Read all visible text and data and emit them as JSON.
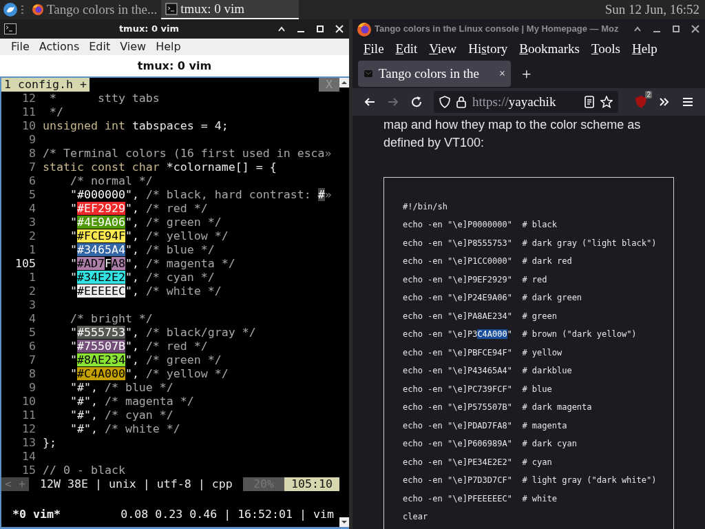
{
  "taskbar": {
    "items": [
      {
        "kind": "browser",
        "label": "Tango colors in the...",
        "selected": false
      },
      {
        "kind": "terminal",
        "label": "tmux: 0 vim",
        "selected": true
      }
    ],
    "clock": "Sun 12 Jun, 16:52"
  },
  "terminal": {
    "title": "tmux: 0 vim",
    "menu": [
      "File",
      "Actions",
      "Edit",
      "View",
      "Help"
    ],
    "tab_title": "tmux: 0 vim",
    "vim": {
      "tab": "1 config.h +",
      "close": "X",
      "lines": [
        {
          "number": "12",
          "current": false,
          "segments": [
            {
              "kind": "comment",
              "text": " *      stty tabs"
            }
          ]
        },
        {
          "number": "11",
          "current": false,
          "segments": [
            {
              "kind": "comment",
              "text": " */"
            }
          ]
        },
        {
          "number": "10",
          "current": false,
          "segments": [
            {
              "kind": "type",
              "text": "unsigned int"
            },
            {
              "kind": "text",
              "text": " tabspaces = 4;"
            }
          ]
        },
        {
          "number": "9",
          "current": false
        },
        {
          "number": "8",
          "current": false,
          "segments": [
            {
              "kind": "comment",
              "text": "/* Terminal colors (16 first used in esca"
            },
            {
              "kind": "more",
              "text": "»"
            }
          ]
        },
        {
          "number": "7",
          "current": false,
          "segments": [
            {
              "kind": "type",
              "text": "static const char"
            },
            {
              "kind": "text",
              "text": " *colorname[] = {"
            }
          ]
        },
        {
          "number": "6",
          "current": false,
          "segments": [
            {
              "kind": "comment",
              "text": "    /* normal */"
            }
          ]
        },
        {
          "number": "5",
          "current": false,
          "segments": [
            {
              "kind": "text",
              "text": "    \""
            },
            {
              "kind": "swatch",
              "text": "#000000",
              "color": "#000000"
            },
            {
              "kind": "text",
              "text": "\", "
            },
            {
              "kind": "comment",
              "text": "/* black, hard contrast: "
            },
            {
              "kind": "mark",
              "text": "#"
            },
            {
              "kind": "more",
              "text": "»"
            }
          ]
        },
        {
          "number": "4",
          "current": false,
          "segments": [
            {
              "kind": "text",
              "text": "    \""
            },
            {
              "kind": "swatch",
              "text": "#EF2929",
              "color": "#ef2929"
            },
            {
              "kind": "text",
              "text": "\", "
            },
            {
              "kind": "comment",
              "text": "/* red */"
            }
          ]
        },
        {
          "number": "3",
          "current": false,
          "segments": [
            {
              "kind": "text",
              "text": "    \""
            },
            {
              "kind": "swatch",
              "text": "#4E9A06",
              "color": "#4e9a06"
            },
            {
              "kind": "text",
              "text": "\", "
            },
            {
              "kind": "comment",
              "text": "/* green */"
            }
          ]
        },
        {
          "number": "2",
          "current": false,
          "segments": [
            {
              "kind": "text",
              "text": "    \""
            },
            {
              "kind": "swatch",
              "text": "#FCE94F",
              "color": "#fce94f"
            },
            {
              "kind": "text",
              "text": "\", "
            },
            {
              "kind": "comment",
              "text": "/* yellow */"
            }
          ]
        },
        {
          "number": "1",
          "current": false,
          "segments": [
            {
              "kind": "text",
              "text": "    \""
            },
            {
              "kind": "swatch",
              "text": "#3465A4",
              "color": "#3465a4"
            },
            {
              "kind": "text",
              "text": "\", "
            },
            {
              "kind": "comment",
              "text": "/* blue */"
            }
          ]
        },
        {
          "number": "105",
          "current": true,
          "segments": [
            {
              "kind": "text",
              "text": "    \""
            },
            {
              "kind": "swatch",
              "text": "#AD7",
              "color": "#ad7fa8"
            },
            {
              "kind": "cursor",
              "text": "F"
            },
            {
              "kind": "swatch",
              "text": "A8",
              "color": "#ad7fa8"
            },
            {
              "kind": "text",
              "text": "\", "
            },
            {
              "kind": "comment",
              "text": "/* magenta */"
            }
          ]
        },
        {
          "number": "1",
          "current": false,
          "segments": [
            {
              "kind": "text",
              "text": "    \""
            },
            {
              "kind": "swatch",
              "text": "#34E2E2",
              "color": "#34e2e2"
            },
            {
              "kind": "text",
              "text": "\", "
            },
            {
              "kind": "comment",
              "text": "/* cyan */"
            }
          ]
        },
        {
          "number": "2",
          "current": false,
          "segments": [
            {
              "kind": "text",
              "text": "    \""
            },
            {
              "kind": "swatch",
              "text": "#EEEEEC",
              "color": "#eeeeec"
            },
            {
              "kind": "text",
              "text": "\", "
            },
            {
              "kind": "comment",
              "text": "/* white */"
            }
          ]
        },
        {
          "number": "3",
          "current": false
        },
        {
          "number": "4",
          "current": false,
          "segments": [
            {
              "kind": "comment",
              "text": "    /* bright */"
            }
          ]
        },
        {
          "number": "5",
          "current": false,
          "segments": [
            {
              "kind": "text",
              "text": "    \""
            },
            {
              "kind": "swatch",
              "text": "#555753",
              "color": "#555753"
            },
            {
              "kind": "text",
              "text": "\", "
            },
            {
              "kind": "comment",
              "text": "/* black/gray */"
            }
          ]
        },
        {
          "number": "6",
          "current": false,
          "segments": [
            {
              "kind": "text",
              "text": "    \""
            },
            {
              "kind": "swatch",
              "text": "#75507B",
              "color": "#75507b"
            },
            {
              "kind": "text",
              "text": "\", "
            },
            {
              "kind": "comment",
              "text": "/* red */"
            }
          ]
        },
        {
          "number": "7",
          "current": false,
          "segments": [
            {
              "kind": "text",
              "text": "    \""
            },
            {
              "kind": "swatch",
              "text": "#8AE234",
              "color": "#8ae234"
            },
            {
              "kind": "text",
              "text": "\", "
            },
            {
              "kind": "comment",
              "text": "/* green */"
            }
          ]
        },
        {
          "number": "8",
          "current": false,
          "segments": [
            {
              "kind": "text",
              "text": "    \""
            },
            {
              "kind": "swatch",
              "text": "#C4A000",
              "color": "#c4a000"
            },
            {
              "kind": "text",
              "text": "\", "
            },
            {
              "kind": "comment",
              "text": "/* yellow */"
            }
          ]
        },
        {
          "number": "9",
          "current": false,
          "segments": [
            {
              "kind": "text",
              "text": "    \"#\", "
            },
            {
              "kind": "comment",
              "text": "/* blue */"
            }
          ]
        },
        {
          "number": "10",
          "current": false,
          "segments": [
            {
              "kind": "text",
              "text": "    \"#\", "
            },
            {
              "kind": "comment",
              "text": "/* magenta */"
            }
          ]
        },
        {
          "number": "11",
          "current": false,
          "segments": [
            {
              "kind": "text",
              "text": "    \"#\", "
            },
            {
              "kind": "comment",
              "text": "/* cyan */"
            }
          ]
        },
        {
          "number": "12",
          "current": false,
          "segments": [
            {
              "kind": "text",
              "text": "    \"#\", "
            },
            {
              "kind": "comment",
              "text": "/* white */"
            }
          ]
        },
        {
          "number": "13",
          "current": false,
          "segments": [
            {
              "kind": "text",
              "text": "};"
            }
          ]
        },
        {
          "number": "14",
          "current": false
        },
        {
          "number": "15",
          "current": false,
          "segments": [
            {
              "kind": "comment",
              "text": "// 0 - black"
            }
          ]
        }
      ],
      "status": {
        "left": "< +",
        "info": "12W 38E | unix | utf-8 | cpp",
        "percent": "20%",
        "position": "105:10"
      }
    },
    "tmux": {
      "window": "*0 vim*",
      "right": "0.08 0.23 0.46 | 16:52:01 | vim"
    }
  },
  "browser": {
    "title": "Tango colors in the Linux console | My Homepage — Moz",
    "menu": [
      {
        "key": "F",
        "post": "ile"
      },
      {
        "key": "E",
        "post": "dit"
      },
      {
        "key": "V",
        "post": "iew"
      },
      {
        "pre": "Hi",
        "key": "s",
        "post": "tory"
      },
      {
        "key": "B",
        "post": "ookmarks"
      },
      {
        "key": "T",
        "post": "ools"
      },
      {
        "key": "H",
        "post": "elp"
      }
    ],
    "tabs": [
      {
        "label": "Tango colors in the",
        "close": "×",
        "selected": true
      }
    ],
    "new_tab": "+",
    "forward_disabled": true,
    "url": {
      "scheme": "https://",
      "host": "yayachik"
    },
    "extension_badge": "2",
    "paragraph": "map and how they map to the color scheme as defined by VT100:",
    "code": [
      [
        {
          "kind": "text",
          "text": "#!/bin/sh"
        }
      ],
      [
        {
          "kind": "text",
          "text": "echo -en \"\\e]P0000000\"  # black"
        }
      ],
      [
        {
          "kind": "text",
          "text": "echo -en \"\\e]P8555753\"  # dark gray (\"light black\")"
        }
      ],
      [
        {
          "kind": "text",
          "text": "echo -en \"\\e]P1CC0000\"  # dark red"
        }
      ],
      [
        {
          "kind": "text",
          "text": "echo -en \"\\e]P9EF2929\"  # red"
        }
      ],
      [
        {
          "kind": "text",
          "text": "echo -en \"\\e]P24E9A06\"  # dark green"
        }
      ],
      [
        {
          "kind": "text",
          "text": "echo -en \"\\e]PA8AE234\"  # green"
        }
      ],
      [
        {
          "kind": "text",
          "text": "echo -en \"\\e]P3"
        },
        {
          "kind": "selection",
          "text": "C4A000"
        },
        {
          "kind": "text",
          "text": "\"  # brown (\"dark yellow\")"
        }
      ],
      [
        {
          "kind": "text",
          "text": "echo -en \"\\e]PBFCE94F\"  # yellow"
        }
      ],
      [
        {
          "kind": "text",
          "text": "echo -en \"\\e]P43465A4\"  # darkblue"
        }
      ],
      [
        {
          "kind": "text",
          "text": "echo -en \"\\e]PC739FCF\"  # blue"
        }
      ],
      [
        {
          "kind": "text",
          "text": "echo -en \"\\e]P575507B\"  # dark magenta"
        }
      ],
      [
        {
          "kind": "text",
          "text": "echo -en \"\\e]PDAD7FA8\"  # magenta"
        }
      ],
      [
        {
          "kind": "text",
          "text": "echo -en \"\\e]P606989A\"  # dark cyan"
        }
      ],
      [
        {
          "kind": "text",
          "text": "echo -en \"\\e]PE34E2E2\"  # cyan"
        }
      ],
      [
        {
          "kind": "text",
          "text": "echo -en \"\\e]P7D3D7CF\"  # light gray (\"dark white\")"
        }
      ],
      [
        {
          "kind": "text",
          "text": "echo -en \"\\e]PFEEEEEC\"  # white"
        }
      ],
      [
        {
          "kind": "text",
          "text": "clear"
        }
      ]
    ]
  }
}
